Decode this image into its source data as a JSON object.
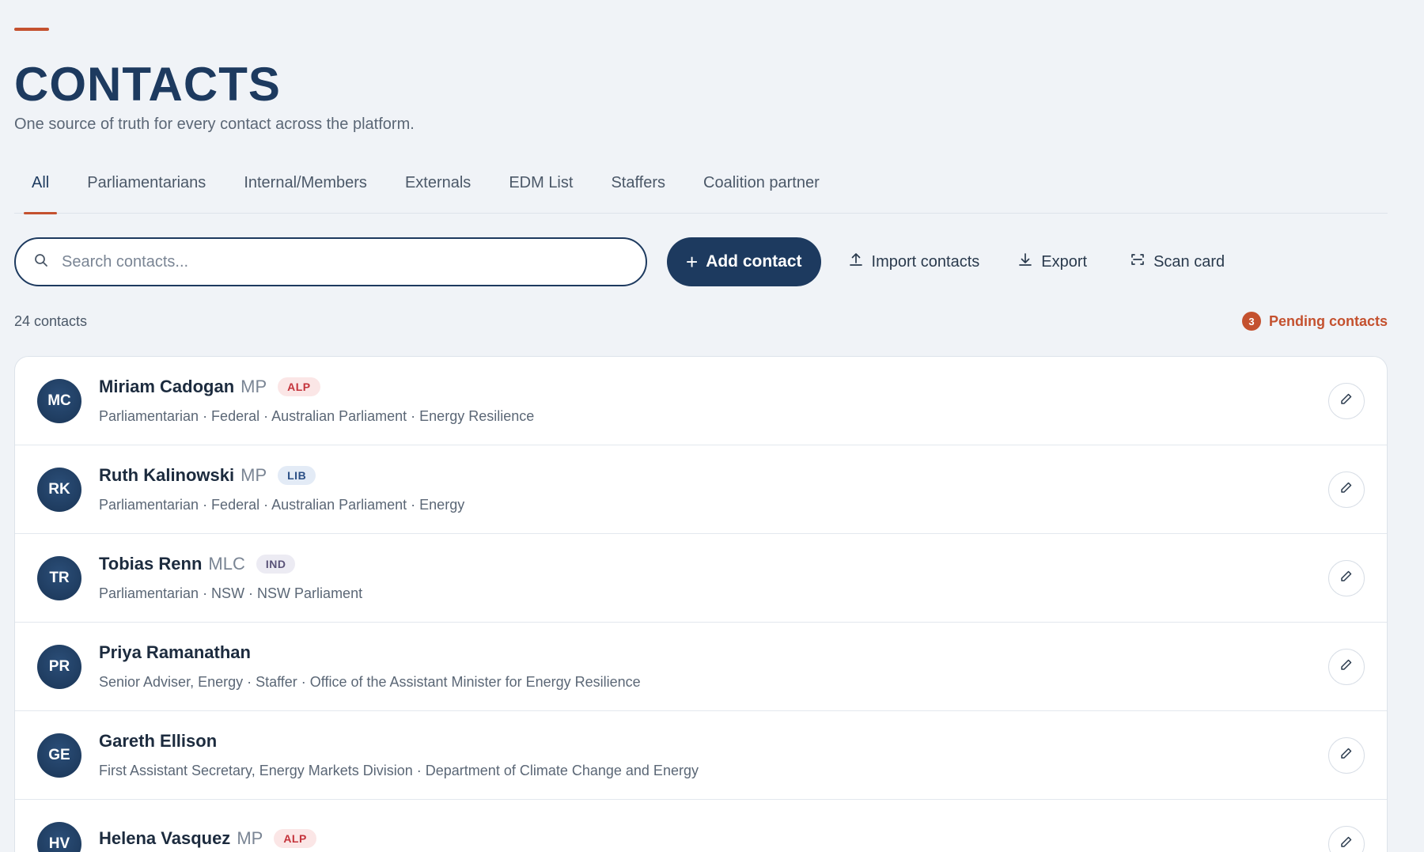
{
  "header": {
    "title": "CONTACTS",
    "subtitle": "One source of truth for every contact across the platform."
  },
  "tabs": [
    {
      "label": "All",
      "active": true
    },
    {
      "label": "Parliamentarians",
      "active": false
    },
    {
      "label": "Internal/Members",
      "active": false
    },
    {
      "label": "Externals",
      "active": false
    },
    {
      "label": "EDM List",
      "active": false
    },
    {
      "label": "Staffers",
      "active": false
    },
    {
      "label": "Coalition partner",
      "active": false
    }
  ],
  "toolbar": {
    "search_placeholder": "Search contacts...",
    "search_value": "",
    "add_label": "Add contact",
    "import_label": "Import contacts",
    "export_label": "Export",
    "scan_label": "Scan card"
  },
  "summary": {
    "count_text": "24 contacts",
    "pending_count": "3",
    "pending_label": "Pending contacts"
  },
  "colors": {
    "accent": "#c4512f",
    "brand": "#1d3a5f",
    "alp": "#c4333b",
    "lib": "#2a4f86",
    "ind": "#5a5378"
  },
  "contacts": [
    {
      "initials": "MC",
      "name": "Miriam Cadogan",
      "suffix": "MP",
      "party": "ALP",
      "party_class": "alp",
      "details": "Parliamentarian · Federal · Australian Parliament · Energy Resilience"
    },
    {
      "initials": "RK",
      "name": "Ruth Kalinowski",
      "suffix": "MP",
      "party": "LIB",
      "party_class": "lib",
      "details": "Parliamentarian · Federal · Australian Parliament · Energy"
    },
    {
      "initials": "TR",
      "name": "Tobias Renn",
      "suffix": "MLC",
      "party": "IND",
      "party_class": "ind",
      "details": "Parliamentarian · NSW · NSW Parliament"
    },
    {
      "initials": "PR",
      "name": "Priya Ramanathan",
      "suffix": "",
      "party": "",
      "party_class": "",
      "details": "Senior Adviser, Energy · Staffer · Office of the Assistant Minister for Energy Resilience"
    },
    {
      "initials": "GE",
      "name": "Gareth Ellison",
      "suffix": "",
      "party": "",
      "party_class": "",
      "details": "First Assistant Secretary, Energy Markets Division · Department of Climate Change and Energy"
    },
    {
      "initials": "HV",
      "name": "Helena Vasquez",
      "suffix": "MP",
      "party": "ALP",
      "party_class": "alp",
      "details": ""
    }
  ]
}
